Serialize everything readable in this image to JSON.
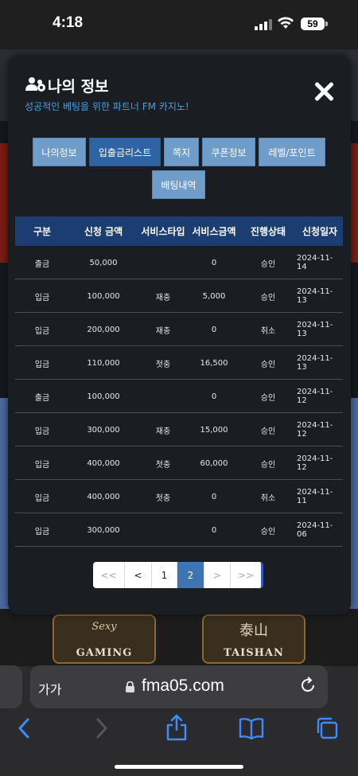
{
  "status_bar": {
    "time": "4:18",
    "battery": "59"
  },
  "modal": {
    "title": "나의 정보",
    "subtitle": "성공적인 베팅을 위한 파트너 FM 카지노!",
    "tabs": [
      {
        "label": "나의정보",
        "active": false
      },
      {
        "label": "입출금리스트",
        "active": true
      },
      {
        "label": "쪽지",
        "active": false
      },
      {
        "label": "쿠폰정보",
        "active": false
      },
      {
        "label": "레벨/포인트",
        "active": false
      },
      {
        "label": "배팅내역",
        "active": false
      }
    ],
    "table": {
      "headers": [
        "구분",
        "신청 금액",
        "서비스타입",
        "서비스금액",
        "진행상태",
        "신청일자"
      ],
      "rows": [
        [
          "출금",
          "50,000",
          "",
          "0",
          "승인",
          "2024-11-14"
        ],
        [
          "입금",
          "100,000",
          "재충",
          "5,000",
          "승인",
          "2024-11-13"
        ],
        [
          "입금",
          "200,000",
          "재충",
          "0",
          "취소",
          "2024-11-13"
        ],
        [
          "입금",
          "110,000",
          "첫충",
          "16,500",
          "승인",
          "2024-11-13"
        ],
        [
          "출금",
          "100,000",
          "",
          "0",
          "승인",
          "2024-11-12"
        ],
        [
          "입금",
          "300,000",
          "재충",
          "15,000",
          "승인",
          "2024-11-12"
        ],
        [
          "입금",
          "400,000",
          "첫충",
          "60,000",
          "승인",
          "2024-11-12"
        ],
        [
          "입금",
          "400,000",
          "첫충",
          "0",
          "취소",
          "2024-11-11"
        ],
        [
          "입금",
          "300,000",
          "",
          "0",
          "승인",
          "2024-11-06"
        ]
      ]
    },
    "pagination": {
      "first": "<<",
      "prev": "<",
      "pages": [
        "1",
        "2"
      ],
      "current_page": "2",
      "next": ">",
      "last": ">>"
    }
  },
  "background": {
    "game_labels": [
      "GAMING",
      "TAISHAN"
    ],
    "game_script": "Sexy",
    "game_script_2": "泰山"
  },
  "browser": {
    "aa_label": "가가",
    "url": "fma05.com",
    "icons": [
      "back-icon",
      "forward-icon",
      "share-icon",
      "bookmarks-icon",
      "tabs-icon"
    ]
  },
  "colors": {
    "tab": "#6f9cc9",
    "tab_active": "#2f64a3",
    "table_header": "#1b3d70",
    "subtitle": "#4aa0e0",
    "page_active": "#3f74b3"
  }
}
